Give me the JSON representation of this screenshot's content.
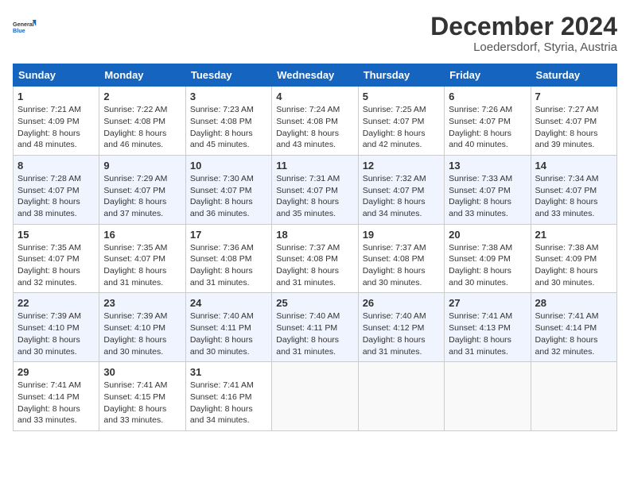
{
  "header": {
    "logo": {
      "general": "General",
      "blue": "Blue"
    },
    "month": "December 2024",
    "location": "Loedersdorf, Styria, Austria"
  },
  "weekdays": [
    "Sunday",
    "Monday",
    "Tuesday",
    "Wednesday",
    "Thursday",
    "Friday",
    "Saturday"
  ],
  "weeks": [
    [
      {
        "day": "1",
        "sunrise": "7:21 AM",
        "sunset": "4:09 PM",
        "daylight": "8 hours and 48 minutes."
      },
      {
        "day": "2",
        "sunrise": "7:22 AM",
        "sunset": "4:08 PM",
        "daylight": "8 hours and 46 minutes."
      },
      {
        "day": "3",
        "sunrise": "7:23 AM",
        "sunset": "4:08 PM",
        "daylight": "8 hours and 45 minutes."
      },
      {
        "day": "4",
        "sunrise": "7:24 AM",
        "sunset": "4:08 PM",
        "daylight": "8 hours and 43 minutes."
      },
      {
        "day": "5",
        "sunrise": "7:25 AM",
        "sunset": "4:07 PM",
        "daylight": "8 hours and 42 minutes."
      },
      {
        "day": "6",
        "sunrise": "7:26 AM",
        "sunset": "4:07 PM",
        "daylight": "8 hours and 40 minutes."
      },
      {
        "day": "7",
        "sunrise": "7:27 AM",
        "sunset": "4:07 PM",
        "daylight": "8 hours and 39 minutes."
      }
    ],
    [
      {
        "day": "8",
        "sunrise": "7:28 AM",
        "sunset": "4:07 PM",
        "daylight": "8 hours and 38 minutes."
      },
      {
        "day": "9",
        "sunrise": "7:29 AM",
        "sunset": "4:07 PM",
        "daylight": "8 hours and 37 minutes."
      },
      {
        "day": "10",
        "sunrise": "7:30 AM",
        "sunset": "4:07 PM",
        "daylight": "8 hours and 36 minutes."
      },
      {
        "day": "11",
        "sunrise": "7:31 AM",
        "sunset": "4:07 PM",
        "daylight": "8 hours and 35 minutes."
      },
      {
        "day": "12",
        "sunrise": "7:32 AM",
        "sunset": "4:07 PM",
        "daylight": "8 hours and 34 minutes."
      },
      {
        "day": "13",
        "sunrise": "7:33 AM",
        "sunset": "4:07 PM",
        "daylight": "8 hours and 33 minutes."
      },
      {
        "day": "14",
        "sunrise": "7:34 AM",
        "sunset": "4:07 PM",
        "daylight": "8 hours and 33 minutes."
      }
    ],
    [
      {
        "day": "15",
        "sunrise": "7:35 AM",
        "sunset": "4:07 PM",
        "daylight": "8 hours and 32 minutes."
      },
      {
        "day": "16",
        "sunrise": "7:35 AM",
        "sunset": "4:07 PM",
        "daylight": "8 hours and 31 minutes."
      },
      {
        "day": "17",
        "sunrise": "7:36 AM",
        "sunset": "4:08 PM",
        "daylight": "8 hours and 31 minutes."
      },
      {
        "day": "18",
        "sunrise": "7:37 AM",
        "sunset": "4:08 PM",
        "daylight": "8 hours and 31 minutes."
      },
      {
        "day": "19",
        "sunrise": "7:37 AM",
        "sunset": "4:08 PM",
        "daylight": "8 hours and 30 minutes."
      },
      {
        "day": "20",
        "sunrise": "7:38 AM",
        "sunset": "4:09 PM",
        "daylight": "8 hours and 30 minutes."
      },
      {
        "day": "21",
        "sunrise": "7:38 AM",
        "sunset": "4:09 PM",
        "daylight": "8 hours and 30 minutes."
      }
    ],
    [
      {
        "day": "22",
        "sunrise": "7:39 AM",
        "sunset": "4:10 PM",
        "daylight": "8 hours and 30 minutes."
      },
      {
        "day": "23",
        "sunrise": "7:39 AM",
        "sunset": "4:10 PM",
        "daylight": "8 hours and 30 minutes."
      },
      {
        "day": "24",
        "sunrise": "7:40 AM",
        "sunset": "4:11 PM",
        "daylight": "8 hours and 30 minutes."
      },
      {
        "day": "25",
        "sunrise": "7:40 AM",
        "sunset": "4:11 PM",
        "daylight": "8 hours and 31 minutes."
      },
      {
        "day": "26",
        "sunrise": "7:40 AM",
        "sunset": "4:12 PM",
        "daylight": "8 hours and 31 minutes."
      },
      {
        "day": "27",
        "sunrise": "7:41 AM",
        "sunset": "4:13 PM",
        "daylight": "8 hours and 31 minutes."
      },
      {
        "day": "28",
        "sunrise": "7:41 AM",
        "sunset": "4:14 PM",
        "daylight": "8 hours and 32 minutes."
      }
    ],
    [
      {
        "day": "29",
        "sunrise": "7:41 AM",
        "sunset": "4:14 PM",
        "daylight": "8 hours and 33 minutes."
      },
      {
        "day": "30",
        "sunrise": "7:41 AM",
        "sunset": "4:15 PM",
        "daylight": "8 hours and 33 minutes."
      },
      {
        "day": "31",
        "sunrise": "7:41 AM",
        "sunset": "4:16 PM",
        "daylight": "8 hours and 34 minutes."
      },
      null,
      null,
      null,
      null
    ]
  ],
  "labels": {
    "sunrise": "Sunrise:",
    "sunset": "Sunset:",
    "daylight": "Daylight:"
  }
}
